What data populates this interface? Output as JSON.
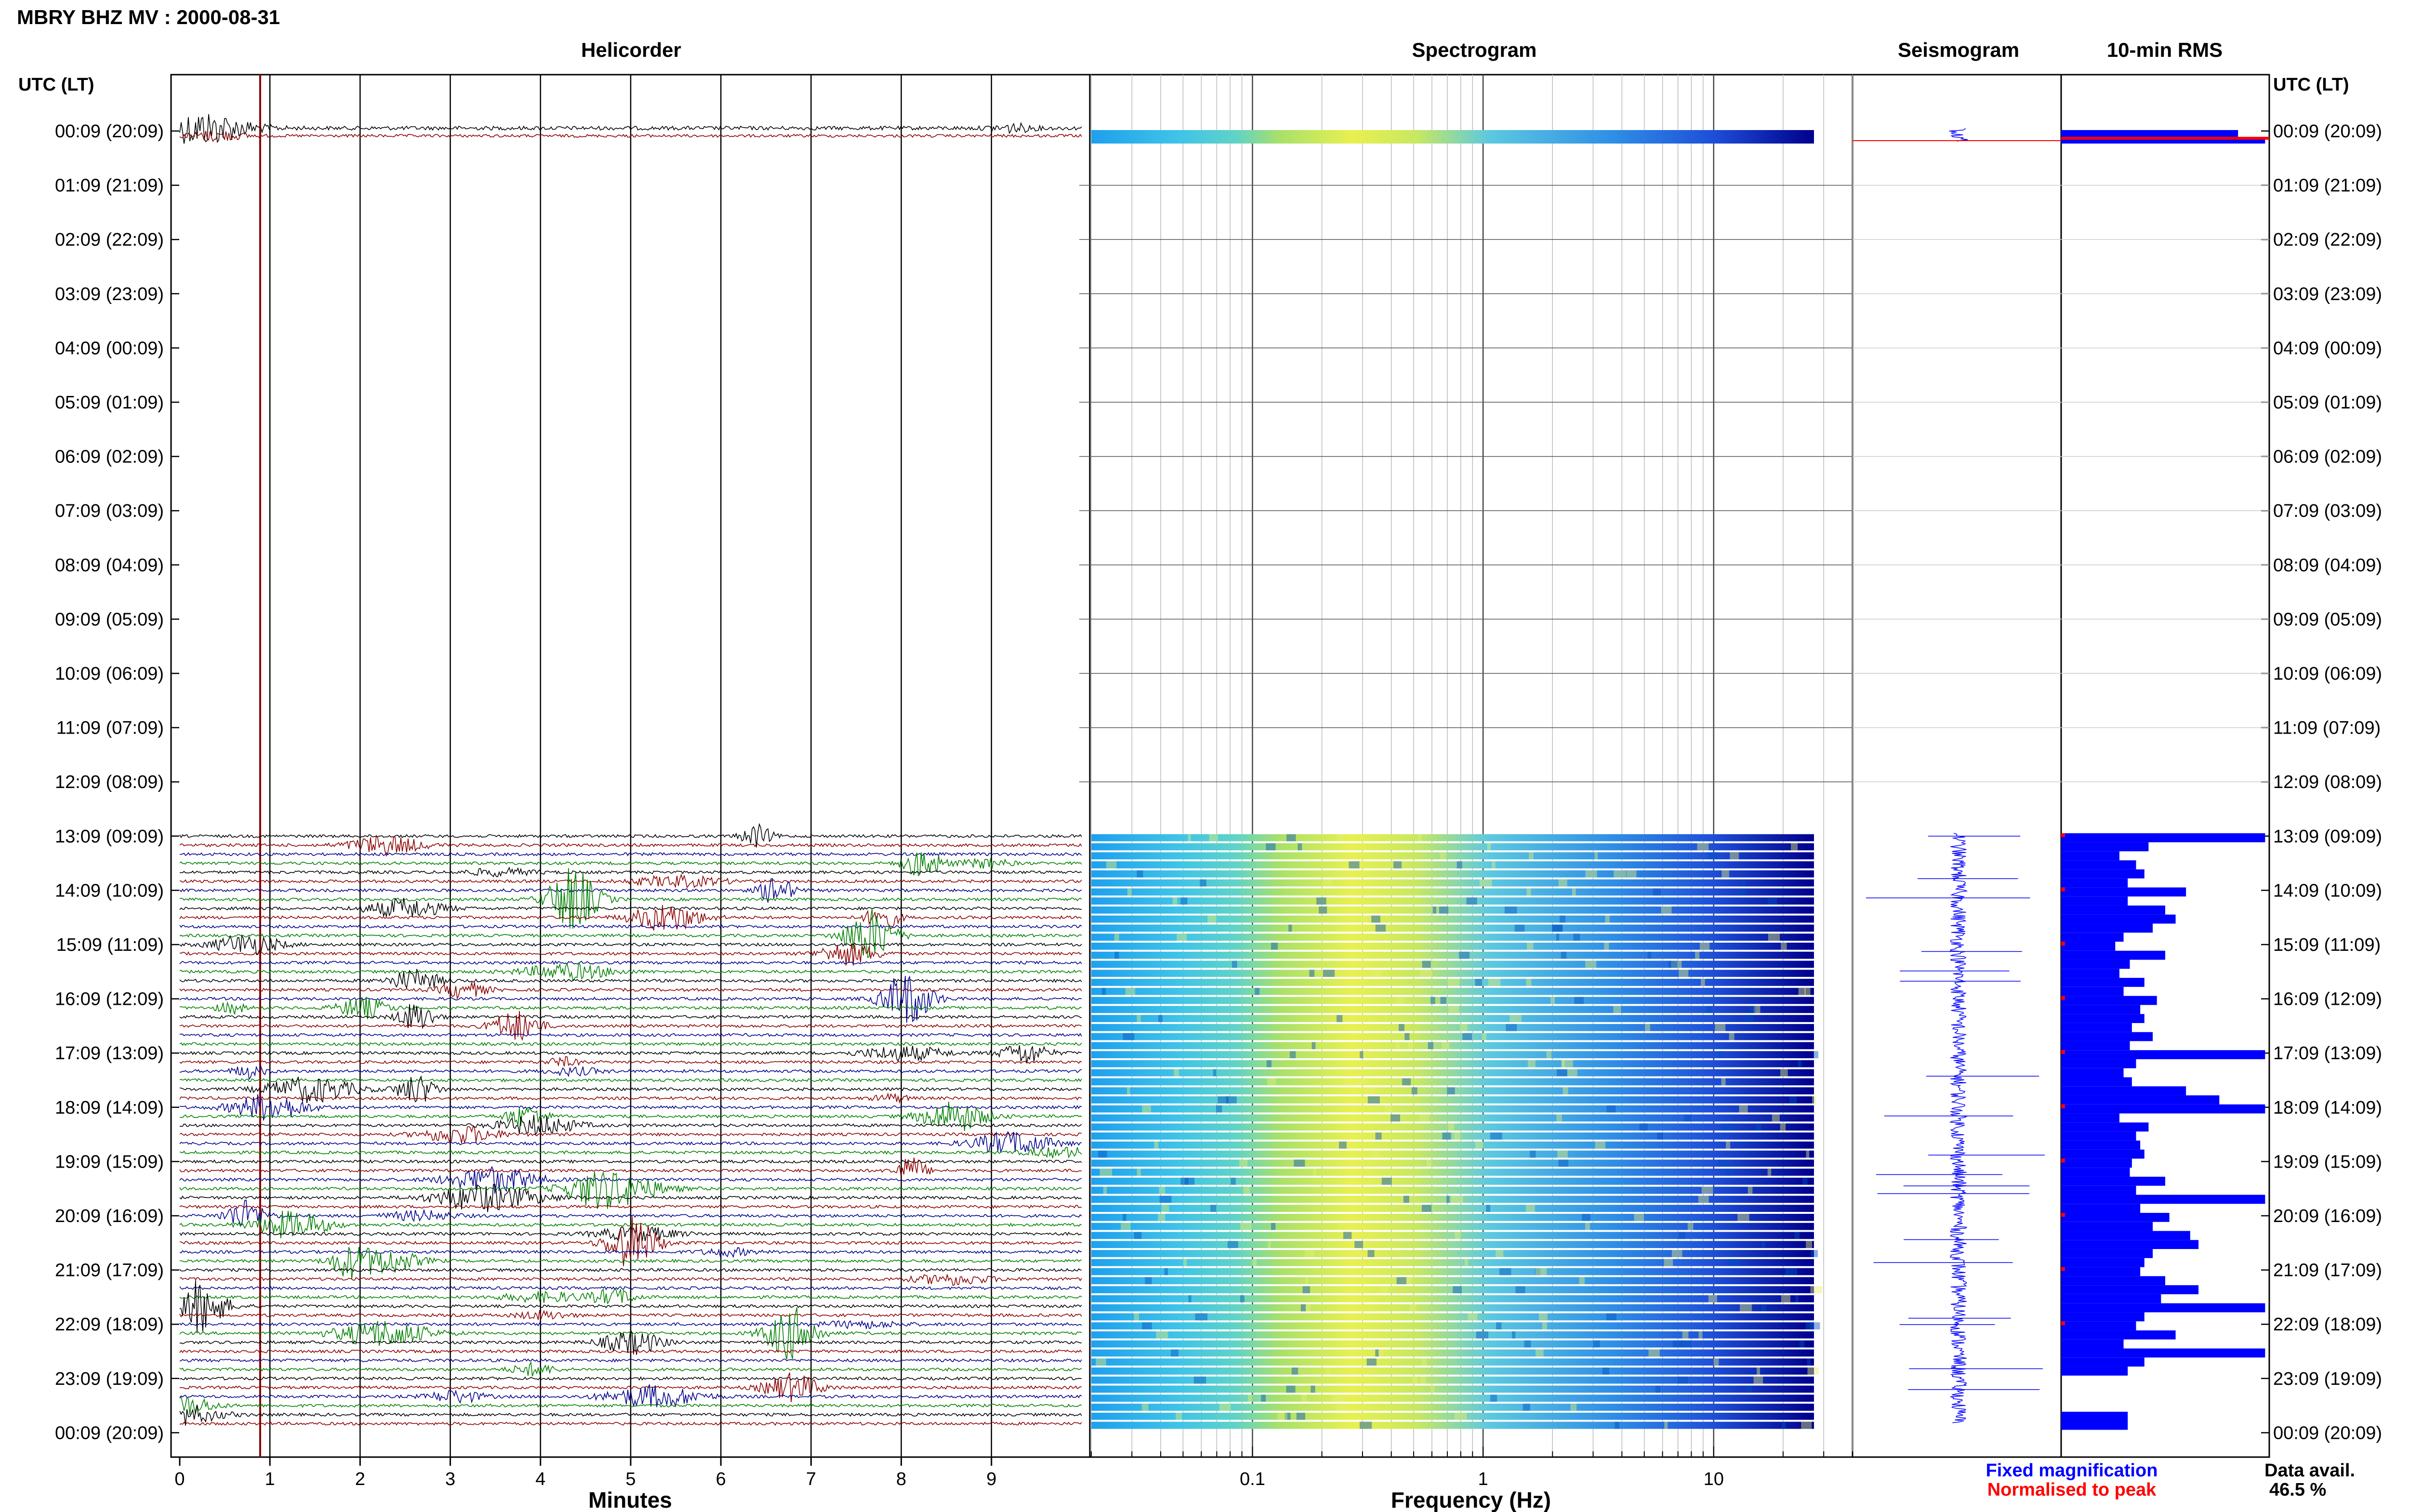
{
  "header": {
    "title": "MBRY BHZ MV : 2000-08-31"
  },
  "panels": {
    "helicorder": "Helicorder",
    "spectrogram": "Spectrogram",
    "seismogram": "Seismogram",
    "rms": "10-min RMS"
  },
  "axes": {
    "left_label": "UTC (LT)",
    "right_label": "UTC (LT)",
    "time_labels": [
      "00:09 (20:09)",
      "01:09 (21:09)",
      "02:09 (22:09)",
      "03:09 (23:09)",
      "04:09 (00:09)",
      "05:09 (01:09)",
      "06:09 (02:09)",
      "07:09 (03:09)",
      "08:09 (04:09)",
      "09:09 (05:09)",
      "10:09 (06:09)",
      "11:09 (07:09)",
      "12:09 (08:09)",
      "13:09 (09:09)",
      "14:09 (10:09)",
      "15:09 (11:09)",
      "16:09 (12:09)",
      "17:09 (13:09)",
      "18:09 (14:09)",
      "19:09 (15:09)",
      "20:09 (16:09)",
      "21:09 (17:09)",
      "22:09 (18:09)",
      "23:09 (19:09)",
      "00:09 (20:09)"
    ],
    "minutes_label": "Minutes",
    "minutes_ticks": [
      "0",
      "1",
      "2",
      "3",
      "4",
      "5",
      "6",
      "7",
      "8",
      "9"
    ],
    "frequency_label": "Frequency (Hz)",
    "frequency_ticks": [
      "0.1",
      "1",
      "10"
    ]
  },
  "legend": {
    "fixed": "Fixed magnification",
    "normalised": "Normalised to peak",
    "fixed_color": "#0000ff",
    "normalised_color": "#ff0000"
  },
  "availability": {
    "label": "Data avail.",
    "value": "46.5 %"
  },
  "colors": {
    "trace_cycle": [
      "#000000",
      "#8b0000",
      "#00008b",
      "#008000"
    ],
    "rms_bar": "#0000ff",
    "marker": "#8b0000"
  },
  "chart_data": {
    "type": "heatmap",
    "title": "MBRY BHZ MV : 2000-08-31",
    "hour_rows": 24,
    "traces_per_hour": 6,
    "data_start_hour_utc": 13,
    "helicorder_xlim": [
      0,
      10
    ],
    "spectrogram_xlim_hz": [
      0.02,
      40
    ],
    "rms_values_13_to_24": [
      [
        0.98,
        0.42,
        0.28,
        0.36,
        0.4,
        0.32
      ],
      [
        0.6,
        0.32,
        0.5,
        0.55,
        0.44,
        0.3
      ],
      [
        0.26,
        0.5,
        0.33,
        0.28,
        0.4,
        0.3
      ],
      [
        0.46,
        0.38,
        0.4,
        0.34,
        0.44,
        0.33
      ],
      [
        0.98,
        0.36,
        0.3,
        0.34,
        0.6,
        0.76
      ],
      [
        0.98,
        0.28,
        0.42,
        0.36,
        0.38,
        0.4
      ],
      [
        0.34,
        0.33,
        0.5,
        0.36,
        0.98,
        0.38
      ],
      [
        0.52,
        0.44,
        0.62,
        0.66,
        0.44,
        0.4
      ],
      [
        0.38,
        0.5,
        0.66,
        0.48,
        0.98,
        0.4
      ],
      [
        0.36,
        0.55,
        0.3,
        0.98,
        0.4,
        0.32
      ]
    ],
    "rms_first_row": [
      0.85,
      0.98
    ]
  }
}
